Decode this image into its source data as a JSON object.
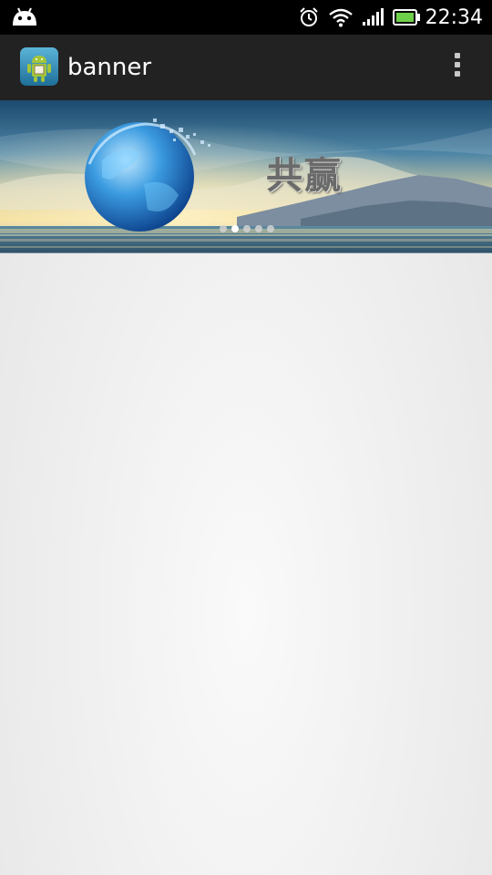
{
  "status_bar": {
    "time": "22:34",
    "icons": [
      "android-notification-icon",
      "alarm-clock-icon",
      "wifi-icon",
      "signal-icon",
      "battery-icon"
    ]
  },
  "action_bar": {
    "title": "banner",
    "app_icon": "android-app-icon",
    "overflow_icon": "overflow-menu-icon"
  },
  "banner": {
    "text": "共赢",
    "image": "globe-over-sea-sunset",
    "page_count": 5,
    "active_page": 2
  },
  "colors": {
    "status_bar_bg": "#000000",
    "action_bar_bg": "#222222",
    "content_bg": "#eeeeee"
  }
}
